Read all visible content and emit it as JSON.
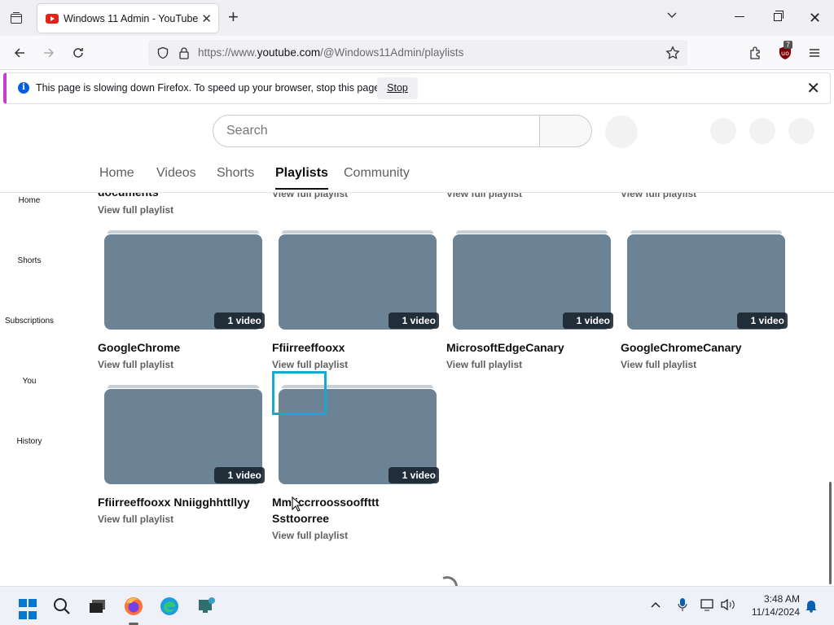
{
  "browser": {
    "tab_title": "Windows 11 Admin - YouTube",
    "new_tab": "+",
    "url_prefix": "https://www.",
    "url_domain": "youtube.com",
    "url_path": "/@Windows11Admin/playlists",
    "extension_badge": "7"
  },
  "notification": {
    "message": "This page is slowing down Firefox. To speed up your browser, stop this page.",
    "stop_label": "Stop",
    "info_glyph": "i"
  },
  "youtube": {
    "search_placeholder": "Search",
    "tabs": [
      "Home",
      "Videos",
      "Shorts",
      "Playlists",
      "Community"
    ],
    "active_tab": "Playlists",
    "sidebar": [
      "Home",
      "Shorts",
      "Subscriptions",
      "You",
      "History"
    ],
    "top_row_partial_title": "documents",
    "view_full_playlist": "View full playlist",
    "playlists": [
      {
        "title": "GoogleChrome",
        "count": "1 video"
      },
      {
        "title": "Ffiirreeffooxx",
        "count": "1 video"
      },
      {
        "title": "MicrosoftEdgeCanary",
        "count": "1 video"
      },
      {
        "title": "GoogleChromeCanary",
        "count": "1 video"
      },
      {
        "title": "Ffiirreeffooxx Nniigghhttllyy",
        "count": "1 video"
      },
      {
        "title": "Mmiiccrroossooffttt Ssttoorree",
        "count": "1 video"
      }
    ]
  },
  "taskbar": {
    "time": "3:48 AM",
    "date": "11/14/2024"
  },
  "colors": {
    "thumbnail": "#6b8394",
    "selection_highlight": "#19a7d4",
    "notification_accent": "#c73bd3"
  }
}
